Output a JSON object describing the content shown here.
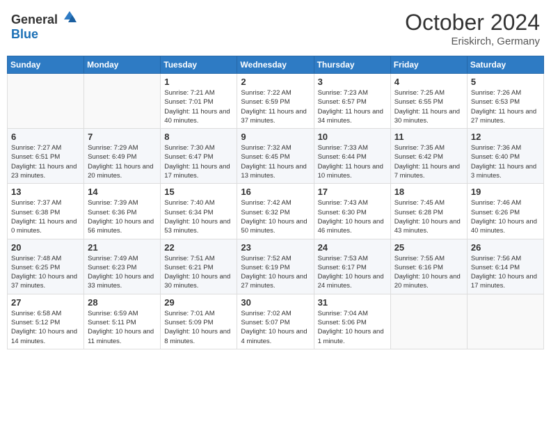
{
  "header": {
    "logo_general": "General",
    "logo_blue": "Blue",
    "month": "October 2024",
    "location": "Eriskirch, Germany"
  },
  "weekdays": [
    "Sunday",
    "Monday",
    "Tuesday",
    "Wednesday",
    "Thursday",
    "Friday",
    "Saturday"
  ],
  "weeks": [
    [
      {
        "day": "",
        "detail": ""
      },
      {
        "day": "",
        "detail": ""
      },
      {
        "day": "1",
        "detail": "Sunrise: 7:21 AM\nSunset: 7:01 PM\nDaylight: 11 hours and 40 minutes."
      },
      {
        "day": "2",
        "detail": "Sunrise: 7:22 AM\nSunset: 6:59 PM\nDaylight: 11 hours and 37 minutes."
      },
      {
        "day": "3",
        "detail": "Sunrise: 7:23 AM\nSunset: 6:57 PM\nDaylight: 11 hours and 34 minutes."
      },
      {
        "day": "4",
        "detail": "Sunrise: 7:25 AM\nSunset: 6:55 PM\nDaylight: 11 hours and 30 minutes."
      },
      {
        "day": "5",
        "detail": "Sunrise: 7:26 AM\nSunset: 6:53 PM\nDaylight: 11 hours and 27 minutes."
      }
    ],
    [
      {
        "day": "6",
        "detail": "Sunrise: 7:27 AM\nSunset: 6:51 PM\nDaylight: 11 hours and 23 minutes."
      },
      {
        "day": "7",
        "detail": "Sunrise: 7:29 AM\nSunset: 6:49 PM\nDaylight: 11 hours and 20 minutes."
      },
      {
        "day": "8",
        "detail": "Sunrise: 7:30 AM\nSunset: 6:47 PM\nDaylight: 11 hours and 17 minutes."
      },
      {
        "day": "9",
        "detail": "Sunrise: 7:32 AM\nSunset: 6:45 PM\nDaylight: 11 hours and 13 minutes."
      },
      {
        "day": "10",
        "detail": "Sunrise: 7:33 AM\nSunset: 6:44 PM\nDaylight: 11 hours and 10 minutes."
      },
      {
        "day": "11",
        "detail": "Sunrise: 7:35 AM\nSunset: 6:42 PM\nDaylight: 11 hours and 7 minutes."
      },
      {
        "day": "12",
        "detail": "Sunrise: 7:36 AM\nSunset: 6:40 PM\nDaylight: 11 hours and 3 minutes."
      }
    ],
    [
      {
        "day": "13",
        "detail": "Sunrise: 7:37 AM\nSunset: 6:38 PM\nDaylight: 11 hours and 0 minutes."
      },
      {
        "day": "14",
        "detail": "Sunrise: 7:39 AM\nSunset: 6:36 PM\nDaylight: 10 hours and 56 minutes."
      },
      {
        "day": "15",
        "detail": "Sunrise: 7:40 AM\nSunset: 6:34 PM\nDaylight: 10 hours and 53 minutes."
      },
      {
        "day": "16",
        "detail": "Sunrise: 7:42 AM\nSunset: 6:32 PM\nDaylight: 10 hours and 50 minutes."
      },
      {
        "day": "17",
        "detail": "Sunrise: 7:43 AM\nSunset: 6:30 PM\nDaylight: 10 hours and 46 minutes."
      },
      {
        "day": "18",
        "detail": "Sunrise: 7:45 AM\nSunset: 6:28 PM\nDaylight: 10 hours and 43 minutes."
      },
      {
        "day": "19",
        "detail": "Sunrise: 7:46 AM\nSunset: 6:26 PM\nDaylight: 10 hours and 40 minutes."
      }
    ],
    [
      {
        "day": "20",
        "detail": "Sunrise: 7:48 AM\nSunset: 6:25 PM\nDaylight: 10 hours and 37 minutes."
      },
      {
        "day": "21",
        "detail": "Sunrise: 7:49 AM\nSunset: 6:23 PM\nDaylight: 10 hours and 33 minutes."
      },
      {
        "day": "22",
        "detail": "Sunrise: 7:51 AM\nSunset: 6:21 PM\nDaylight: 10 hours and 30 minutes."
      },
      {
        "day": "23",
        "detail": "Sunrise: 7:52 AM\nSunset: 6:19 PM\nDaylight: 10 hours and 27 minutes."
      },
      {
        "day": "24",
        "detail": "Sunrise: 7:53 AM\nSunset: 6:17 PM\nDaylight: 10 hours and 24 minutes."
      },
      {
        "day": "25",
        "detail": "Sunrise: 7:55 AM\nSunset: 6:16 PM\nDaylight: 10 hours and 20 minutes."
      },
      {
        "day": "26",
        "detail": "Sunrise: 7:56 AM\nSunset: 6:14 PM\nDaylight: 10 hours and 17 minutes."
      }
    ],
    [
      {
        "day": "27",
        "detail": "Sunrise: 6:58 AM\nSunset: 5:12 PM\nDaylight: 10 hours and 14 minutes."
      },
      {
        "day": "28",
        "detail": "Sunrise: 6:59 AM\nSunset: 5:11 PM\nDaylight: 10 hours and 11 minutes."
      },
      {
        "day": "29",
        "detail": "Sunrise: 7:01 AM\nSunset: 5:09 PM\nDaylight: 10 hours and 8 minutes."
      },
      {
        "day": "30",
        "detail": "Sunrise: 7:02 AM\nSunset: 5:07 PM\nDaylight: 10 hours and 4 minutes."
      },
      {
        "day": "31",
        "detail": "Sunrise: 7:04 AM\nSunset: 5:06 PM\nDaylight: 10 hours and 1 minute."
      },
      {
        "day": "",
        "detail": ""
      },
      {
        "day": "",
        "detail": ""
      }
    ]
  ]
}
